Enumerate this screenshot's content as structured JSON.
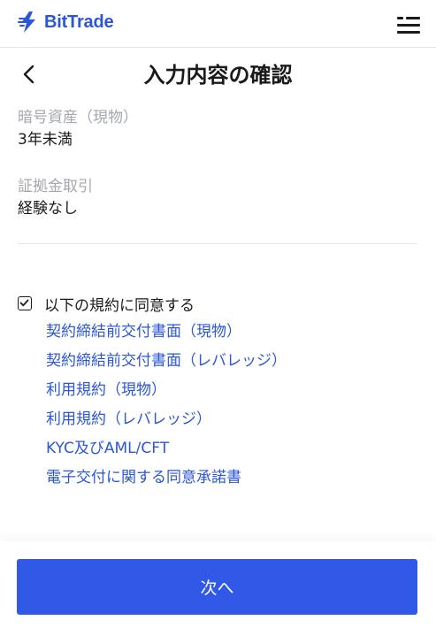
{
  "header": {
    "logo_text": "BitTrade",
    "logo_icon": "bittrade-logo-icon",
    "menu_icon": "hamburger-menu-icon"
  },
  "page": {
    "back_icon": "chevron-left-icon",
    "title": "入力内容の確認"
  },
  "fields": [
    {
      "label": "暗号資産（現物）",
      "value": "3年未満"
    },
    {
      "label": "証拠金取引",
      "value": "経験なし"
    }
  ],
  "agreement": {
    "checked": true,
    "label": "以下の規約に同意する",
    "links": [
      "契約締結前交付書面（現物）",
      "契約締結前交付書面（レバレッジ）",
      "利用規約（現物）",
      "利用規約（レバレッジ）",
      "KYC及びAML/CFT",
      "電子交付に関する同意承諾書"
    ]
  },
  "footer": {
    "next_label": "次へ"
  },
  "colors": {
    "brand": "#2b56d6",
    "primary_button": "#2f59e6",
    "label_gray": "#a3a7ae"
  }
}
